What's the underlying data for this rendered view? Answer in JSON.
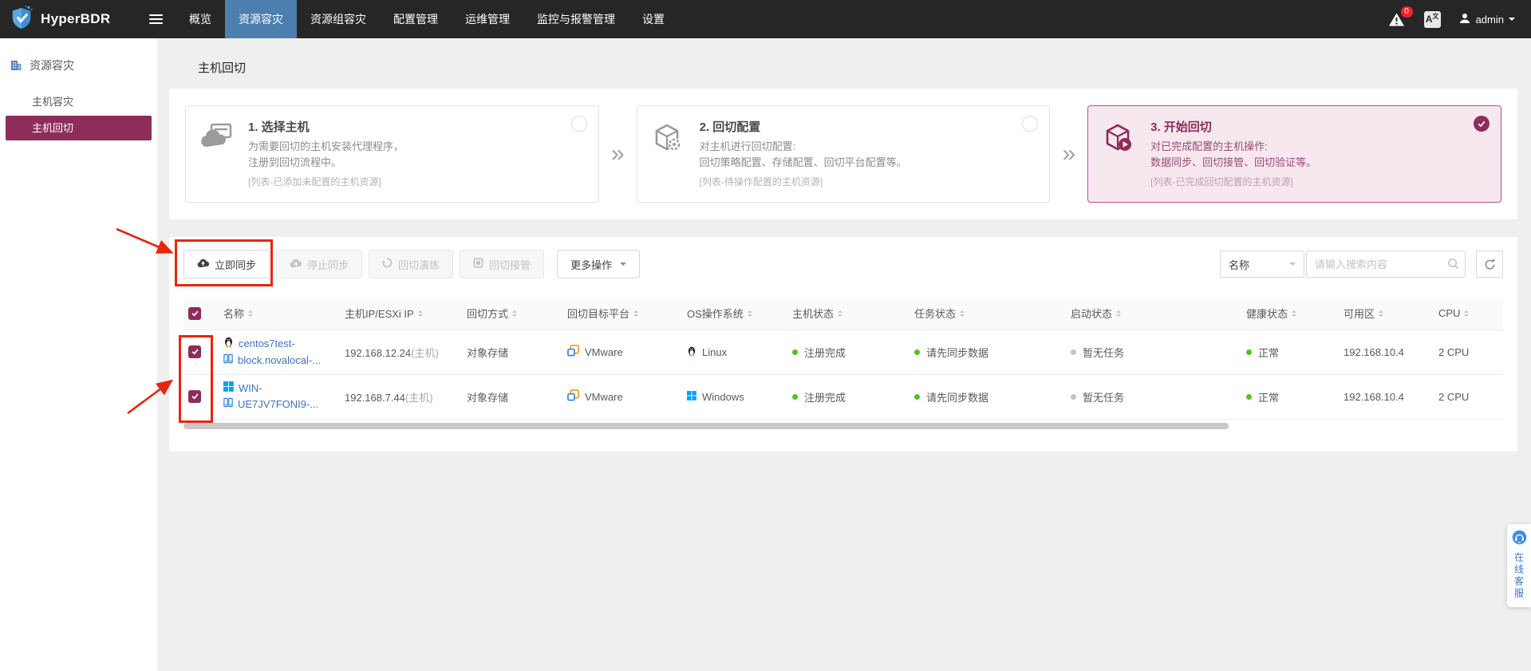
{
  "nav": {
    "brand": "HyperBDR",
    "items": [
      {
        "label": "概览"
      },
      {
        "label": "资源容灾"
      },
      {
        "label": "资源组容灾"
      },
      {
        "label": "配置管理"
      },
      {
        "label": "运维管理"
      },
      {
        "label": "监控与报警管理"
      },
      {
        "label": "设置"
      }
    ],
    "active_index": 1,
    "alarm_badge": "0",
    "user": "admin"
  },
  "sidebar": {
    "section": "资源容灾",
    "items": [
      {
        "label": "主机容灾"
      },
      {
        "label": "主机回切"
      }
    ],
    "active_index": 1
  },
  "page": {
    "title": "主机回切"
  },
  "wizard": {
    "steps": [
      {
        "title": "1. 选择主机",
        "desc1": "为需要回切的主机安装代理程序，",
        "desc2": "注册到回切流程中。",
        "note": "[列表-已添加未配置的主机资源]",
        "done": false
      },
      {
        "title": "2. 回切配置",
        "desc1": "对主机进行回切配置:",
        "desc2": "回切策略配置、存储配置、回切平台配置等。",
        "note": "[列表-待操作配置的主机资源]",
        "done": false
      },
      {
        "title": "3. 开始回切",
        "desc1": "对已完成配置的主机操作:",
        "desc2": "数据同步、回切接管、回切验证等。",
        "note": "[列表-已完成回切配置的主机资源]",
        "done": true
      }
    ]
  },
  "toolbar": {
    "sync_now": "立即同步",
    "stop_sync": "停止同步",
    "rehearse": "回切演练",
    "takeover": "回切接管",
    "more": "更多操作",
    "filter_field": "名称",
    "search_placeholder": "请输入搜索内容"
  },
  "table": {
    "headers": [
      "名称",
      "主机IP/ESXi IP",
      "回切方式",
      "回切目标平台",
      "OS操作系统",
      "主机状态",
      "任务状态",
      "启动状态",
      "健康状态",
      "可用区",
      "CPU"
    ],
    "rows": [
      {
        "name_line1": "centos7test-",
        "name_line2": "block.novalocal-...",
        "ip": "192.168.12.24",
        "ip_suffix": "(主机)",
        "mode": "对象存储",
        "platform": "VMware",
        "os": "Linux",
        "host_status": "注册完成",
        "task_status": "请先同步数据",
        "boot_status": "暂无任务",
        "health_status": "正常",
        "zone": "192.168.10.4",
        "cpu": "2 CPU"
      },
      {
        "name_line1": "WIN-",
        "name_line2": "UE7JV7FONI9-...",
        "ip": "192.168.7.44",
        "ip_suffix": "(主机)",
        "mode": "对象存储",
        "platform": "VMware",
        "os": "Windows",
        "host_status": "注册完成",
        "task_status": "请先同步数据",
        "boot_status": "暂无任务",
        "health_status": "正常",
        "zone": "192.168.10.4",
        "cpu": "2 CPU"
      }
    ]
  },
  "widget": {
    "label": "在线客服"
  },
  "colors": {
    "brand": "#8e2c5c",
    "nav_active": "#4d7fae",
    "annotation": "#e8250c",
    "link": "#3c73c4",
    "success": "#52c41a",
    "platform_orange": "#f5940a",
    "windows_blue": "#00a4ef"
  }
}
